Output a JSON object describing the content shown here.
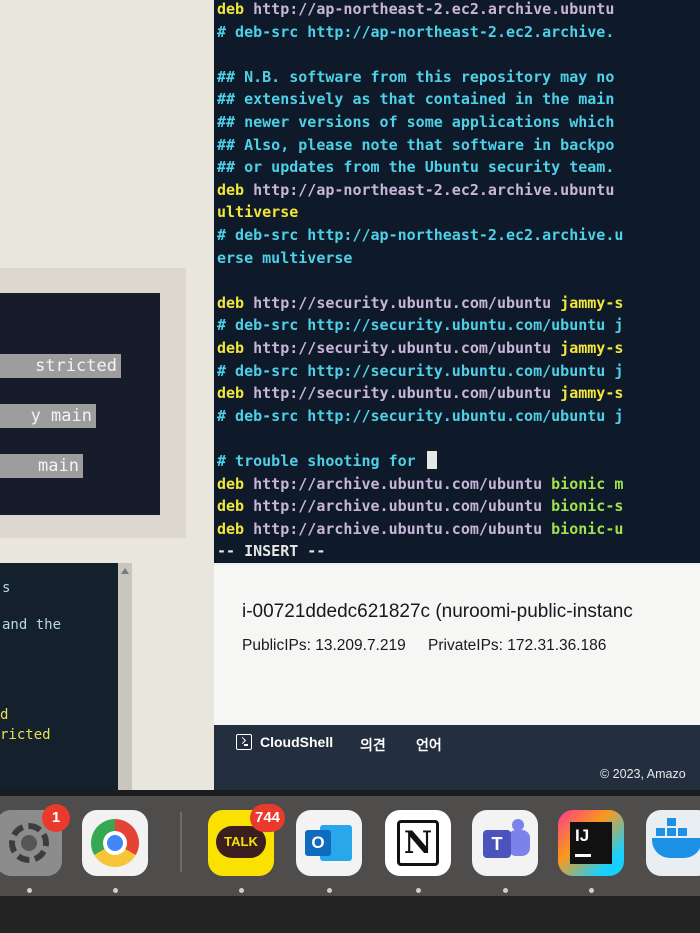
{
  "left_window": {
    "highlight_lines": [
      "stricted",
      "y main",
      "main"
    ],
    "terminal_lines": [
      "s",
      "and the",
      "",
      "",
      "d",
      "ricted"
    ]
  },
  "vim": {
    "lines": [
      [
        {
          "t": "deb",
          "c": "kw-deb"
        },
        {
          "t": " http://ap-northeast-2.ec2.archive.ubuntu",
          "c": "url"
        }
      ],
      [
        {
          "t": "# deb-src http://ap-northeast-2.ec2.archive.",
          "c": "comment"
        }
      ],
      [],
      [
        {
          "t": "## N.B. software from this repository may no",
          "c": "comment"
        }
      ],
      [
        {
          "t": "## extensively as that contained in the main",
          "c": "comment"
        }
      ],
      [
        {
          "t": "## newer versions of some applications which",
          "c": "comment"
        }
      ],
      [
        {
          "t": "## Also, please note that software in backpo",
          "c": "comment"
        }
      ],
      [
        {
          "t": "## or updates from the Ubuntu security team.",
          "c": "comment"
        }
      ],
      [
        {
          "t": "deb",
          "c": "kw-deb"
        },
        {
          "t": " http://ap-northeast-2.ec2.archive.ubuntu",
          "c": "url"
        }
      ],
      [
        {
          "t": "ultiverse",
          "c": "yellow"
        }
      ],
      [
        {
          "t": "# deb-src http://ap-northeast-2.ec2.archive.u",
          "c": "comment"
        }
      ],
      [
        {
          "t": "erse multiverse",
          "c": "comment"
        }
      ],
      [],
      [
        {
          "t": "deb",
          "c": "kw-deb"
        },
        {
          "t": " http://security.ubuntu.com/ubuntu ",
          "c": "url"
        },
        {
          "t": "jammy-s",
          "c": "yellow"
        }
      ],
      [
        {
          "t": "# deb-src http://security.ubuntu.com/ubuntu j",
          "c": "comment"
        }
      ],
      [
        {
          "t": "deb",
          "c": "kw-deb"
        },
        {
          "t": " http://security.ubuntu.com/ubuntu ",
          "c": "url"
        },
        {
          "t": "jammy-s",
          "c": "yellow"
        }
      ],
      [
        {
          "t": "# deb-src http://security.ubuntu.com/ubuntu j",
          "c": "comment"
        }
      ],
      [
        {
          "t": "deb",
          "c": "kw-deb"
        },
        {
          "t": " http://security.ubuntu.com/ubuntu ",
          "c": "url"
        },
        {
          "t": "jammy-s",
          "c": "yellow"
        }
      ],
      [
        {
          "t": "# deb-src http://security.ubuntu.com/ubuntu j",
          "c": "comment"
        }
      ],
      [],
      [
        {
          "t": "# trouble shooting for ",
          "c": "comment"
        },
        {
          "cursor": true
        }
      ],
      [
        {
          "t": "deb",
          "c": "kw-deb"
        },
        {
          "t": " http://archive.ubuntu.com/ubuntu ",
          "c": "url"
        },
        {
          "t": "bionic m",
          "c": "green"
        }
      ],
      [
        {
          "t": "deb",
          "c": "kw-deb"
        },
        {
          "t": " http://archive.ubuntu.com/ubuntu ",
          "c": "url"
        },
        {
          "t": "bionic-s",
          "c": "green"
        }
      ],
      [
        {
          "t": "deb",
          "c": "kw-deb"
        },
        {
          "t": " http://archive.ubuntu.com/ubuntu ",
          "c": "url"
        },
        {
          "t": "bionic-u",
          "c": "green"
        }
      ],
      [
        {
          "t": "-- INSERT --",
          "c": "white"
        }
      ]
    ]
  },
  "instance": {
    "id_line": "i-00721ddedc621827c (nuroomi-public-instanc",
    "public_ips": "PublicIPs: 13.209.7.219",
    "private_ips": "PrivateIPs: 172.31.36.186"
  },
  "footer": {
    "cloudshell_label": "CloudShell",
    "feedback_label": "의견",
    "language_label": "언어",
    "copyright": "© 2023, Amazo"
  },
  "dock": {
    "settings_badge": "1",
    "kakao_label": "TALK",
    "kakao_badge": "744",
    "outlook_letter": "O",
    "notion_letter": "N",
    "teams_letter": "T",
    "intellij_letters": "IJ"
  }
}
